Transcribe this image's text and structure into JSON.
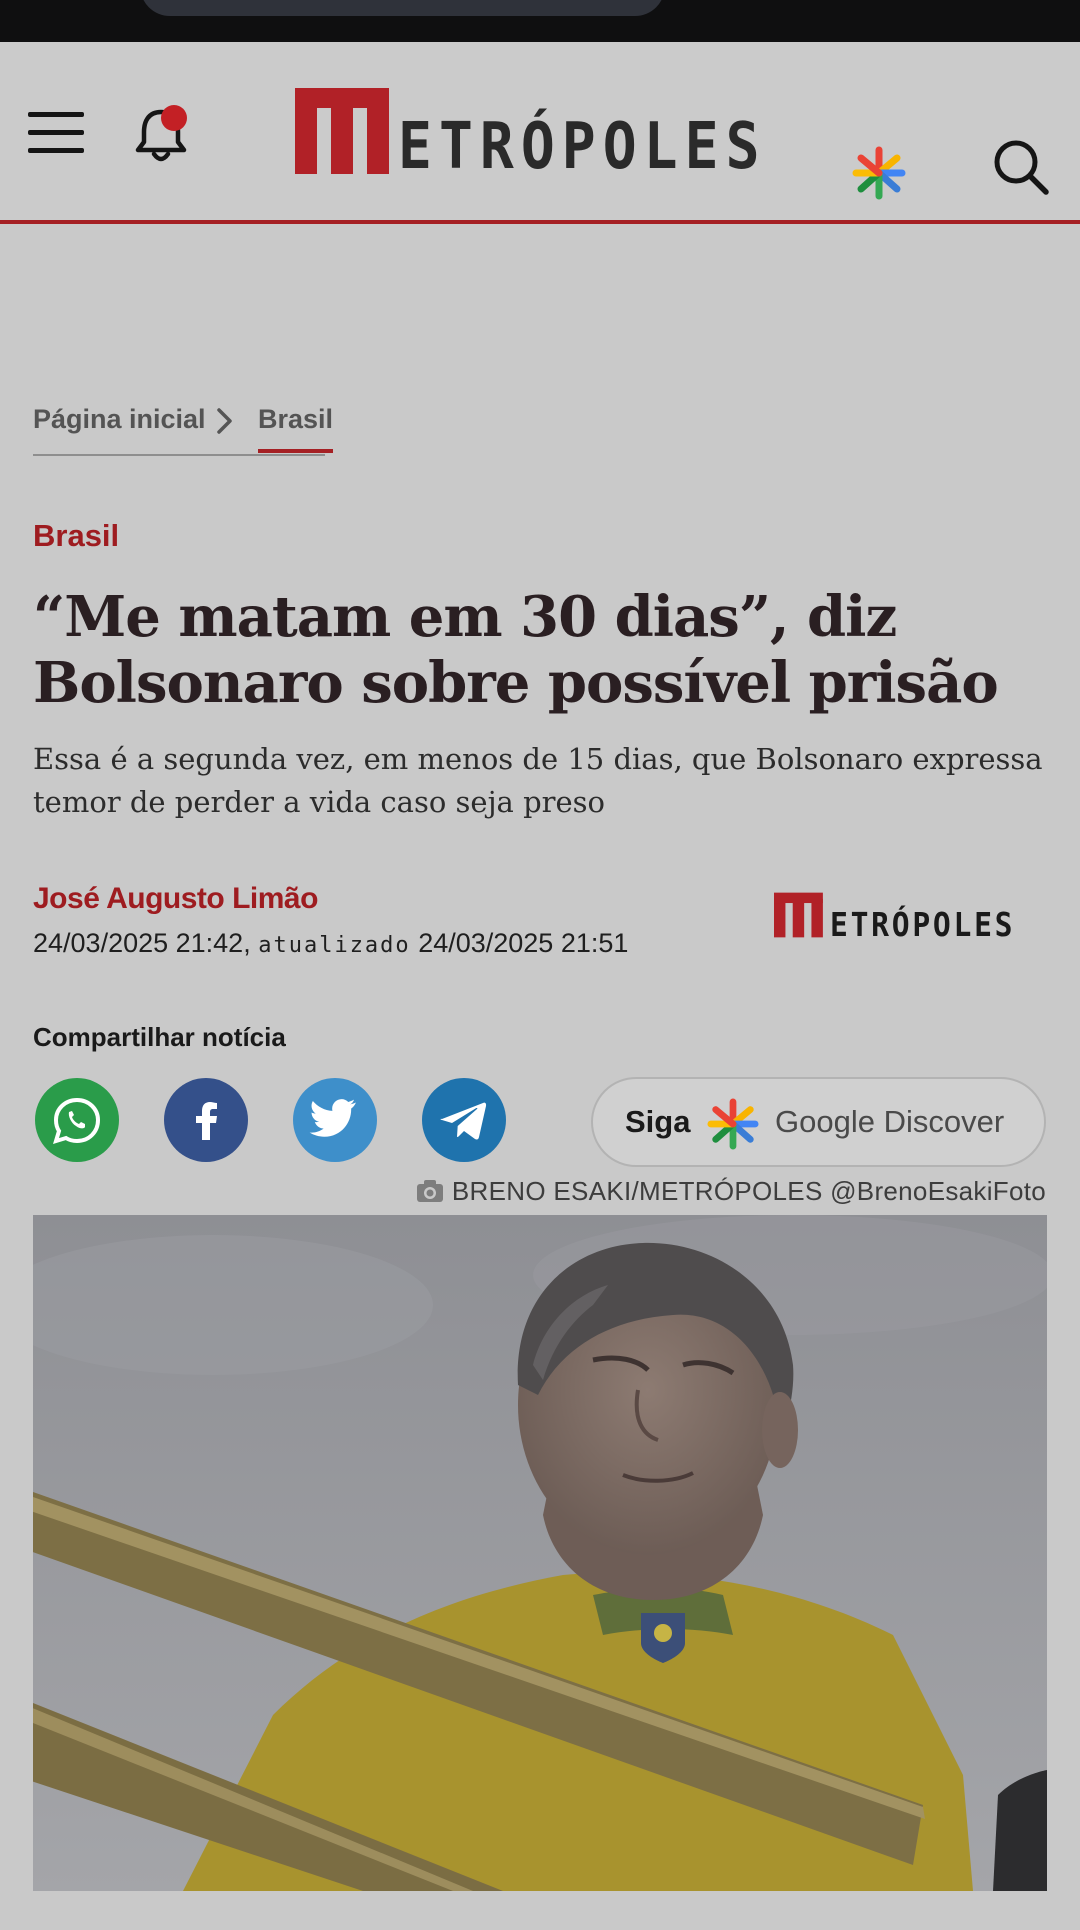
{
  "header": {
    "site_name": "ETRÓPOLES",
    "logo_mark": "M",
    "icons": [
      "menu-icon",
      "bell-icon",
      "asterisk-icon",
      "search-icon"
    ]
  },
  "breadcrumb": {
    "home": "Página inicial",
    "current": "Brasil"
  },
  "article": {
    "category": "Brasil",
    "headline": "“Me matam em 30 dias”, diz Bolsonaro sobre possível prisão",
    "subtitle": "Essa é a segunda vez, em menos de 15 dias, que Bolsonaro expressa temor de perder a vida caso seja preso",
    "author": "José Augusto Limão",
    "published": "24/03/2025 21:42,",
    "updated_label": "atualizado",
    "updated": "24/03/2025 21:51",
    "share_label": "Compartilhar notícia",
    "share_buttons": [
      "whatsapp-icon",
      "facebook-icon",
      "twitter-icon",
      "telegram-icon"
    ],
    "discover": {
      "siga": "Siga",
      "label": "Google Discover"
    },
    "photo_credit": "BRENO ESAKI/METRÓPOLES @BrenoEsakiFoto"
  },
  "colors": {
    "brand_red": "#a52024",
    "category_red": "#9e1c20",
    "whatsapp": "#2a9c4a",
    "facebook": "#34508a",
    "twitter": "#3e8fca",
    "telegram": "#1f73ad"
  }
}
